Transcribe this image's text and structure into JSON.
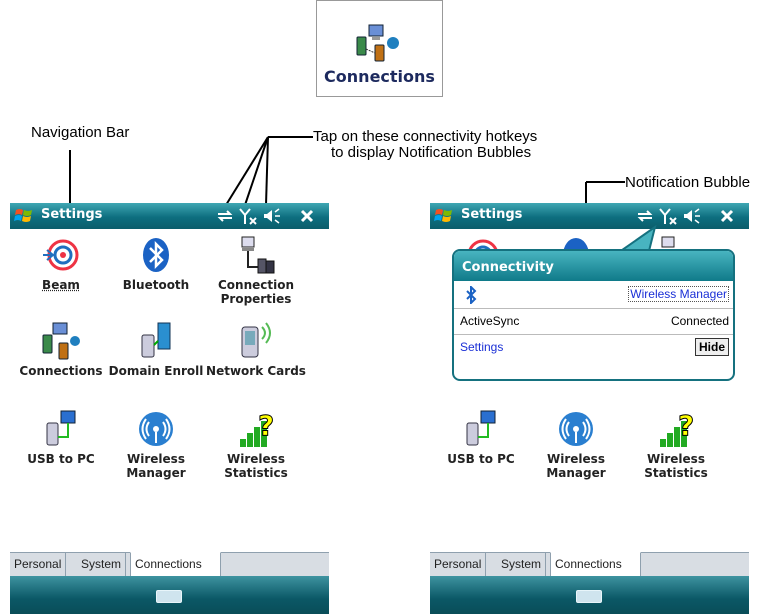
{
  "header_tile": {
    "label": "Connections",
    "icon": "connections-icon"
  },
  "callouts": {
    "navigation_bar": "Navigation Bar",
    "hotkeys_line1": "Tap on these connectivity hotkeys",
    "hotkeys_line2": "to display Notification Bubbles",
    "notification_bubble": "Notification Bubble"
  },
  "device": {
    "title": "Settings",
    "items": [
      {
        "label": "Beam",
        "icon": "beam-icon"
      },
      {
        "label": "Bluetooth",
        "icon": "bluetooth-icon"
      },
      {
        "label": "Connection Properties",
        "icon": "connection-properties-icon"
      },
      {
        "label": "Connections",
        "icon": "connections-icon"
      },
      {
        "label": "Domain Enroll",
        "icon": "domain-enroll-icon"
      },
      {
        "label": "Network Cards",
        "icon": "network-cards-icon"
      },
      {
        "label": "USB to PC",
        "icon": "usb-to-pc-icon"
      },
      {
        "label": "Wireless Manager",
        "icon": "wireless-manager-icon"
      },
      {
        "label": "Wireless Statistics",
        "icon": "wireless-statistics-icon"
      }
    ],
    "tabs": [
      "Personal",
      "System",
      "Connections"
    ],
    "active_tab": "Connections"
  },
  "bubble": {
    "title": "Connectivity",
    "wireless_link": "Wireless Manager",
    "activesync_label": "ActiveSync",
    "activesync_status": "Connected",
    "settings_link": "Settings",
    "hide_button": "Hide"
  },
  "colors": {
    "titlebar": "#0d6e7f",
    "link": "#1a2fd6",
    "accent": "#15717f"
  }
}
